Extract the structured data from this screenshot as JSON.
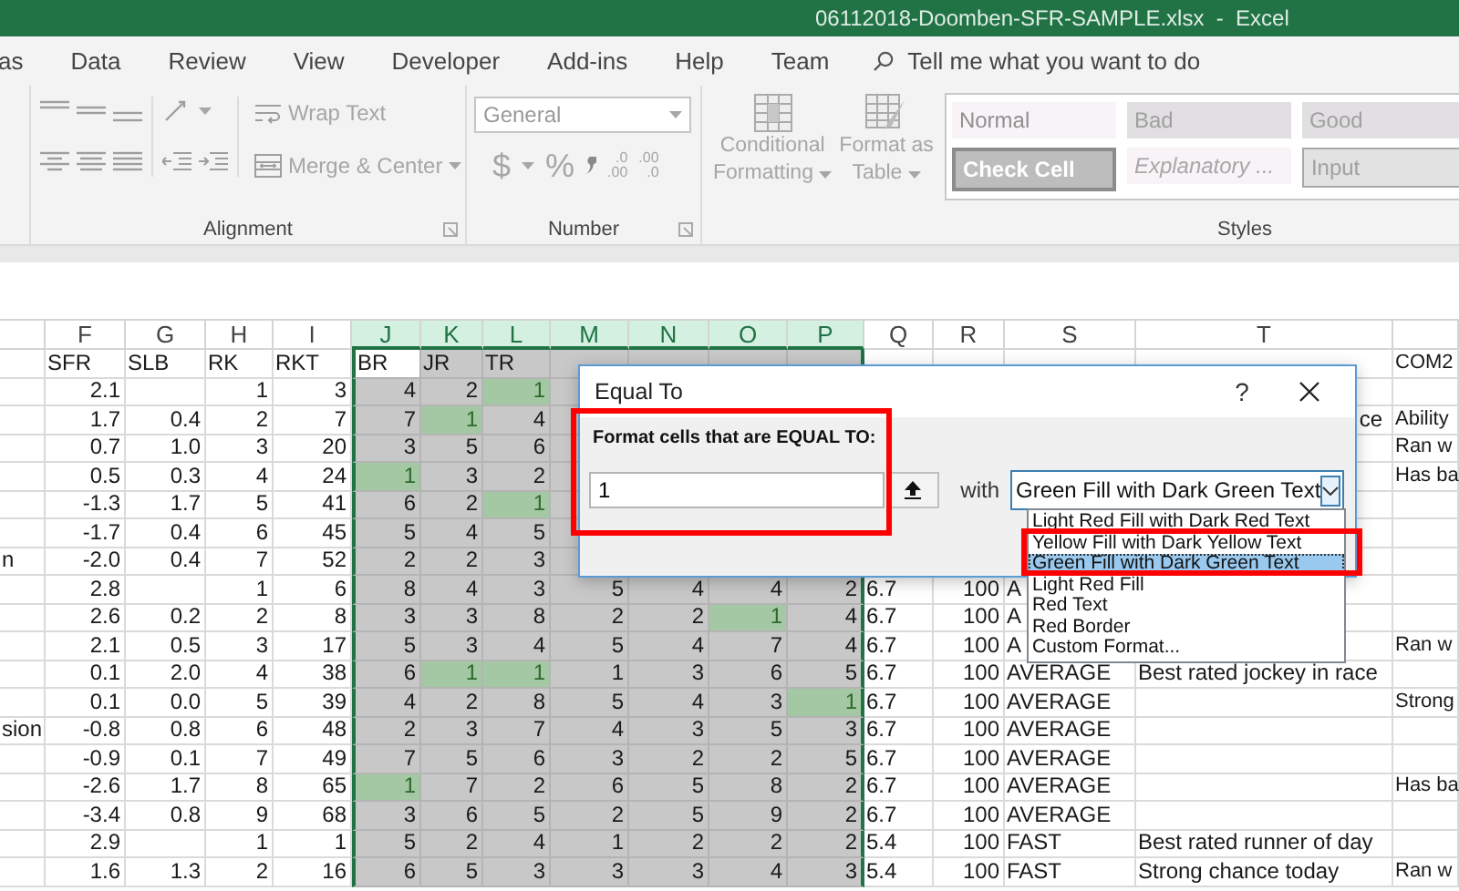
{
  "window": {
    "title": "06112018-Doomben-SFR-SAMPLE.xlsx  -  Excel"
  },
  "tabs": [
    "as",
    "Data",
    "Review",
    "View",
    "Developer",
    "Add-ins",
    "Help",
    "Team"
  ],
  "tell_me": {
    "placeholder": "Tell me what you want to do"
  },
  "ribbon": {
    "alignment": {
      "wrap_text": "Wrap Text",
      "merge": "Merge & Center",
      "label": "Alignment"
    },
    "number": {
      "format": "General",
      "currency": "$",
      "percent": "%",
      "decimals": [
        [
          ".0",
          ".00"
        ],
        [
          ".00",
          ".0"
        ]
      ],
      "label": "Number"
    },
    "styles": {
      "conditional": [
        "Conditional",
        "Formatting"
      ],
      "format_table": [
        "Format as",
        "Table"
      ],
      "gallery": [
        {
          "text": "Normal",
          "kind": "normal"
        },
        {
          "text": "Bad",
          "kind": "bad"
        },
        {
          "text": "Good",
          "kind": "good"
        },
        {
          "text": "Check Cell",
          "kind": "check"
        },
        {
          "text": "Explanatory ...",
          "kind": "explanatory"
        },
        {
          "text": "Input",
          "kind": "input"
        }
      ],
      "label": "Styles"
    }
  },
  "columns": [
    {
      "letter": "F",
      "selected": false
    },
    {
      "letter": "G",
      "selected": false
    },
    {
      "letter": "H",
      "selected": false
    },
    {
      "letter": "I",
      "selected": false
    },
    {
      "letter": "J",
      "selected": true
    },
    {
      "letter": "K",
      "selected": true
    },
    {
      "letter": "L",
      "selected": true
    },
    {
      "letter": "M",
      "selected": true
    },
    {
      "letter": "N",
      "selected": true
    },
    {
      "letter": "O",
      "selected": true
    },
    {
      "letter": "P",
      "selected": true
    },
    {
      "letter": "Q",
      "selected": false
    },
    {
      "letter": "R",
      "selected": false
    },
    {
      "letter": "S",
      "selected": false
    },
    {
      "letter": "T",
      "selected": false
    }
  ],
  "rows": [
    {
      "kind": "header",
      "cells": {
        "F": "SFR",
        "G": "SLB",
        "H": "RK",
        "I": "RKT",
        "U": "COM2"
      },
      "range": {
        "J": {
          "text": "BR",
          "highlighted": false,
          "active": true
        },
        "K": {
          "text": "JR",
          "highlighted": false,
          "active": false
        },
        "L": {
          "text": "TR",
          "highlighted": false,
          "active": false
        }
      }
    },
    {
      "kind": "data",
      "cells": {
        "F": "2.1",
        "H": "1",
        "I": "3"
      },
      "range": {
        "J": {
          "text": "4",
          "highlighted": false
        },
        "K": {
          "text": "2",
          "highlighted": false
        },
        "L": {
          "text": "1",
          "highlighted": true
        }
      }
    },
    {
      "kind": "data",
      "cells": {
        "F": "1.7",
        "G": "0.4",
        "H": "2",
        "I": "7",
        "U": "Ability"
      },
      "t_visible_end": "ce",
      "range": {
        "J": {
          "text": "7",
          "highlighted": false
        },
        "K": {
          "text": "1",
          "highlighted": true
        },
        "L": {
          "text": "4",
          "highlighted": false
        }
      }
    },
    {
      "kind": "data",
      "cells": {
        "F": "0.7",
        "G": "1.0",
        "H": "3",
        "I": "20",
        "U": "Ran w"
      },
      "range": {
        "J": {
          "text": "3",
          "highlighted": false
        },
        "K": {
          "text": "5",
          "highlighted": false
        },
        "L": {
          "text": "6",
          "highlighted": false
        }
      }
    },
    {
      "kind": "data",
      "cells": {
        "F": "0.5",
        "G": "0.3",
        "H": "4",
        "I": "24",
        "U": "Has ba"
      },
      "range": {
        "J": {
          "text": "1",
          "highlighted": true
        },
        "K": {
          "text": "3",
          "highlighted": false
        },
        "L": {
          "text": "2",
          "highlighted": false
        }
      }
    },
    {
      "kind": "data",
      "cells": {
        "F": "-1.3",
        "G": "1.7",
        "H": "5",
        "I": "41"
      },
      "range": {
        "J": {
          "text": "6",
          "highlighted": false
        },
        "K": {
          "text": "2",
          "highlighted": false
        },
        "L": {
          "text": "1",
          "highlighted": true
        }
      }
    },
    {
      "kind": "data",
      "cells": {
        "F": "-1.7",
        "G": "0.4",
        "H": "6",
        "I": "45"
      },
      "range": {
        "J": {
          "text": "5",
          "highlighted": false
        },
        "K": {
          "text": "4",
          "highlighted": false
        },
        "L": {
          "text": "5",
          "highlighted": false
        }
      }
    },
    {
      "kind": "data",
      "cells": {
        "E": "n",
        "F": "-2.0",
        "G": "0.4",
        "H": "7",
        "I": "52"
      },
      "range": {
        "J": {
          "text": "2",
          "highlighted": false
        },
        "K": {
          "text": "2",
          "highlighted": false
        },
        "L": {
          "text": "3",
          "highlighted": false
        }
      }
    },
    {
      "kind": "data",
      "cells": {
        "F": "2.8",
        "H": "1",
        "I": "6",
        "Q": "6.7",
        "R": "100",
        "S": "A"
      },
      "range": {
        "J": {
          "text": "8",
          "highlighted": false
        },
        "K": {
          "text": "4",
          "highlighted": false
        },
        "L": {
          "text": "3",
          "highlighted": false
        },
        "M": {
          "text": "5",
          "highlighted": false
        },
        "N": {
          "text": "4",
          "highlighted": false
        },
        "O": {
          "text": "4",
          "highlighted": false
        },
        "P": {
          "text": "2",
          "highlighted": false
        }
      }
    },
    {
      "kind": "data",
      "cells": {
        "F": "2.6",
        "G": "0.2",
        "H": "2",
        "I": "8",
        "Q": "6.7",
        "R": "100",
        "S": "A"
      },
      "range": {
        "J": {
          "text": "3",
          "highlighted": false
        },
        "K": {
          "text": "3",
          "highlighted": false
        },
        "L": {
          "text": "8",
          "highlighted": false
        },
        "M": {
          "text": "2",
          "highlighted": false
        },
        "N": {
          "text": "2",
          "highlighted": false
        },
        "O": {
          "text": "1",
          "highlighted": true
        },
        "P": {
          "text": "4",
          "highlighted": false
        }
      }
    },
    {
      "kind": "data",
      "cells": {
        "F": "2.1",
        "G": "0.5",
        "H": "3",
        "I": "17",
        "Q": "6.7",
        "R": "100",
        "S": "A",
        "U": "Ran w"
      },
      "range": {
        "J": {
          "text": "5",
          "highlighted": false
        },
        "K": {
          "text": "3",
          "highlighted": false
        },
        "L": {
          "text": "4",
          "highlighted": false
        },
        "M": {
          "text": "5",
          "highlighted": false
        },
        "N": {
          "text": "4",
          "highlighted": false
        },
        "O": {
          "text": "7",
          "highlighted": false
        },
        "P": {
          "text": "4",
          "highlighted": false
        }
      }
    },
    {
      "kind": "data",
      "cells": {
        "F": "0.1",
        "G": "2.0",
        "H": "4",
        "I": "38",
        "Q": "6.7",
        "R": "100",
        "S": "AVERAGE",
        "T": "Best rated jockey in race"
      },
      "range": {
        "J": {
          "text": "6",
          "highlighted": false
        },
        "K": {
          "text": "1",
          "highlighted": true
        },
        "L": {
          "text": "1",
          "highlighted": true
        },
        "M": {
          "text": "1",
          "highlighted": false
        },
        "N": {
          "text": "3",
          "highlighted": false
        },
        "O": {
          "text": "6",
          "highlighted": false
        },
        "P": {
          "text": "5",
          "highlighted": false
        }
      }
    },
    {
      "kind": "data",
      "cells": {
        "F": "0.1",
        "G": "0.0",
        "H": "5",
        "I": "39",
        "Q": "6.7",
        "R": "100",
        "S": "AVERAGE",
        "U": "Strong"
      },
      "range": {
        "J": {
          "text": "4",
          "highlighted": false
        },
        "K": {
          "text": "2",
          "highlighted": false
        },
        "L": {
          "text": "8",
          "highlighted": false
        },
        "M": {
          "text": "5",
          "highlighted": false
        },
        "N": {
          "text": "4",
          "highlighted": false
        },
        "O": {
          "text": "3",
          "highlighted": false
        },
        "P": {
          "text": "1",
          "highlighted": true
        }
      }
    },
    {
      "kind": "data",
      "cells": {
        "E": "sion",
        "F": "-0.8",
        "G": "0.8",
        "H": "6",
        "I": "48",
        "Q": "6.7",
        "R": "100",
        "S": "AVERAGE"
      },
      "range": {
        "J": {
          "text": "2",
          "highlighted": false
        },
        "K": {
          "text": "3",
          "highlighted": false
        },
        "L": {
          "text": "7",
          "highlighted": false
        },
        "M": {
          "text": "4",
          "highlighted": false
        },
        "N": {
          "text": "3",
          "highlighted": false
        },
        "O": {
          "text": "5",
          "highlighted": false
        },
        "P": {
          "text": "3",
          "highlighted": false
        }
      }
    },
    {
      "kind": "data",
      "cells": {
        "F": "-0.9",
        "G": "0.1",
        "H": "7",
        "I": "49",
        "Q": "6.7",
        "R": "100",
        "S": "AVERAGE"
      },
      "range": {
        "J": {
          "text": "7",
          "highlighted": false
        },
        "K": {
          "text": "5",
          "highlighted": false
        },
        "L": {
          "text": "6",
          "highlighted": false
        },
        "M": {
          "text": "3",
          "highlighted": false
        },
        "N": {
          "text": "2",
          "highlighted": false
        },
        "O": {
          "text": "2",
          "highlighted": false
        },
        "P": {
          "text": "5",
          "highlighted": false
        }
      }
    },
    {
      "kind": "data",
      "cells": {
        "F": "-2.6",
        "G": "1.7",
        "H": "8",
        "I": "65",
        "Q": "6.7",
        "R": "100",
        "S": "AVERAGE",
        "U": "Has ba"
      },
      "range": {
        "J": {
          "text": "1",
          "highlighted": true
        },
        "K": {
          "text": "7",
          "highlighted": false
        },
        "L": {
          "text": "2",
          "highlighted": false
        },
        "M": {
          "text": "6",
          "highlighted": false
        },
        "N": {
          "text": "5",
          "highlighted": false
        },
        "O": {
          "text": "8",
          "highlighted": false
        },
        "P": {
          "text": "2",
          "highlighted": false
        }
      }
    },
    {
      "kind": "data",
      "cells": {
        "F": "-3.4",
        "G": "0.8",
        "H": "9",
        "I": "68",
        "Q": "6.7",
        "R": "100",
        "S": "AVERAGE"
      },
      "range": {
        "J": {
          "text": "3",
          "highlighted": false
        },
        "K": {
          "text": "6",
          "highlighted": false
        },
        "L": {
          "text": "5",
          "highlighted": false
        },
        "M": {
          "text": "2",
          "highlighted": false
        },
        "N": {
          "text": "5",
          "highlighted": false
        },
        "O": {
          "text": "9",
          "highlighted": false
        },
        "P": {
          "text": "2",
          "highlighted": false
        }
      }
    },
    {
      "kind": "data",
      "cells": {
        "F": "2.9",
        "H": "1",
        "I": "1",
        "Q": "5.4",
        "R": "100",
        "S": "FAST",
        "T": "Best rated runner of day"
      },
      "range": {
        "J": {
          "text": "5",
          "highlighted": false
        },
        "K": {
          "text": "2",
          "highlighted": false
        },
        "L": {
          "text": "4",
          "highlighted": false
        },
        "M": {
          "text": "1",
          "highlighted": false
        },
        "N": {
          "text": "2",
          "highlighted": false
        },
        "O": {
          "text": "2",
          "highlighted": false
        },
        "P": {
          "text": "2",
          "highlighted": false
        }
      }
    },
    {
      "kind": "data",
      "cells": {
        "F": "1.6",
        "G": "1.3",
        "H": "2",
        "I": "16",
        "Q": "5.4",
        "R": "100",
        "S": "FAST",
        "T": "Strong chance today",
        "U": "Ran w"
      },
      "range": {
        "J": {
          "text": "6",
          "highlighted": false
        },
        "K": {
          "text": "5",
          "highlighted": false
        },
        "L": {
          "text": "3",
          "highlighted": false
        },
        "M": {
          "text": "3",
          "highlighted": false
        },
        "N": {
          "text": "3",
          "highlighted": false
        },
        "O": {
          "text": "4",
          "highlighted": false
        },
        "P": {
          "text": "3",
          "highlighted": false
        }
      }
    }
  ],
  "dialog": {
    "title": "Equal To",
    "help": "?",
    "prompt": "Format cells that are EQUAL TO:",
    "value": "1",
    "with": "with",
    "format": {
      "value": "Green Fill with Dark Green Text",
      "expanded": true
    },
    "options": [
      {
        "text": "Light Red Fill with Dark Red Text",
        "selected": false
      },
      {
        "text": "Yellow Fill with Dark Yellow Text",
        "selected": false
      },
      {
        "text": "Green Fill with Dark Green Text",
        "selected": true
      },
      {
        "text": "Light Red Fill",
        "selected": false
      },
      {
        "text": "Red Text",
        "selected": false
      },
      {
        "text": "Red Border",
        "selected": false
      },
      {
        "text": "Custom Format...",
        "selected": false
      }
    ]
  }
}
